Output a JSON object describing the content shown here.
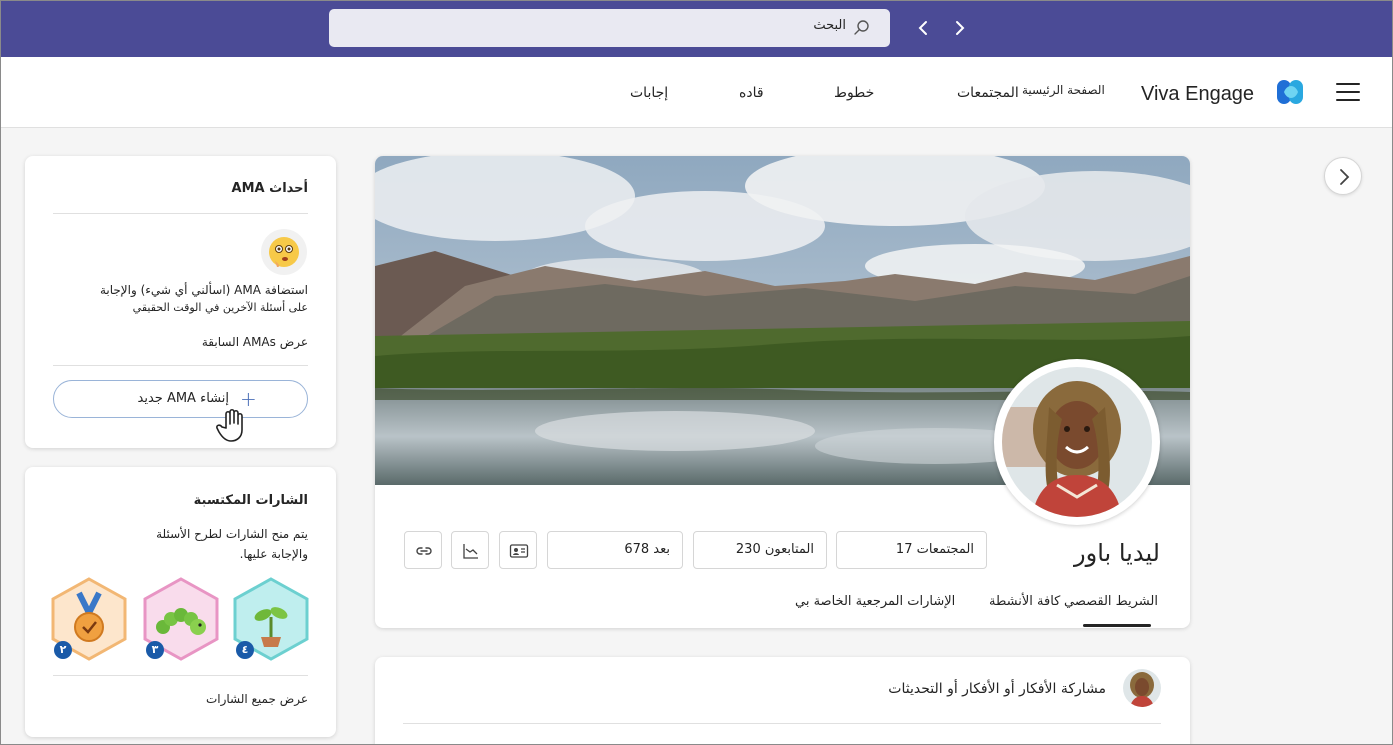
{
  "topbar": {
    "search_label": "البحث"
  },
  "header": {
    "app_name": "Viva Engage",
    "nav": [
      {
        "label": "الصفحة الرئيسية"
      },
      {
        "label": "المجتمعات"
      },
      {
        "label": "خطوط"
      },
      {
        "label": "قاده"
      },
      {
        "label": "إجابات"
      }
    ]
  },
  "profile": {
    "name": "ليديا باور",
    "stats": {
      "communities": "المجتمعات 17",
      "followers": "المتابعون 230",
      "following": "بعد 678"
    },
    "tabs": [
      {
        "label": "الشريط القصصي"
      },
      {
        "label": "كافة الأنشطة"
      },
      {
        "label": "الإشارات المرجعية الخاصة بي"
      }
    ]
  },
  "post": {
    "prompt": "مشاركة الأفكار أو الأفكار أو التحديثات"
  },
  "ama": {
    "title": "أحداث AMA",
    "desc_line1": "استضافة AMA (اسألني أي شيء) والإجابة",
    "desc_line2": "على أسئلة الآخرين في الوقت الحقيقي",
    "view_past": "عرض AMAs السابقة",
    "create_label": "إنشاء AMA جديد"
  },
  "badges": {
    "title": "الشارات المكتسبة",
    "desc_line1": "يتم منح الشارات لطرح الأسئلة",
    "desc_line2": "والإجابة عليها.",
    "items": [
      {
        "name": "seedling-badge",
        "count": "٤",
        "color": "#5cc6c6"
      },
      {
        "name": "caterpillar-badge",
        "count": "٣",
        "color": "#e27fb8"
      },
      {
        "name": "medal-badge",
        "count": "٢",
        "color": "#f2b774"
      }
    ],
    "view_all": "عرض جميع الشارات"
  },
  "colors": {
    "topbar": "#4b4b96",
    "accent": "#1a5aa8"
  }
}
